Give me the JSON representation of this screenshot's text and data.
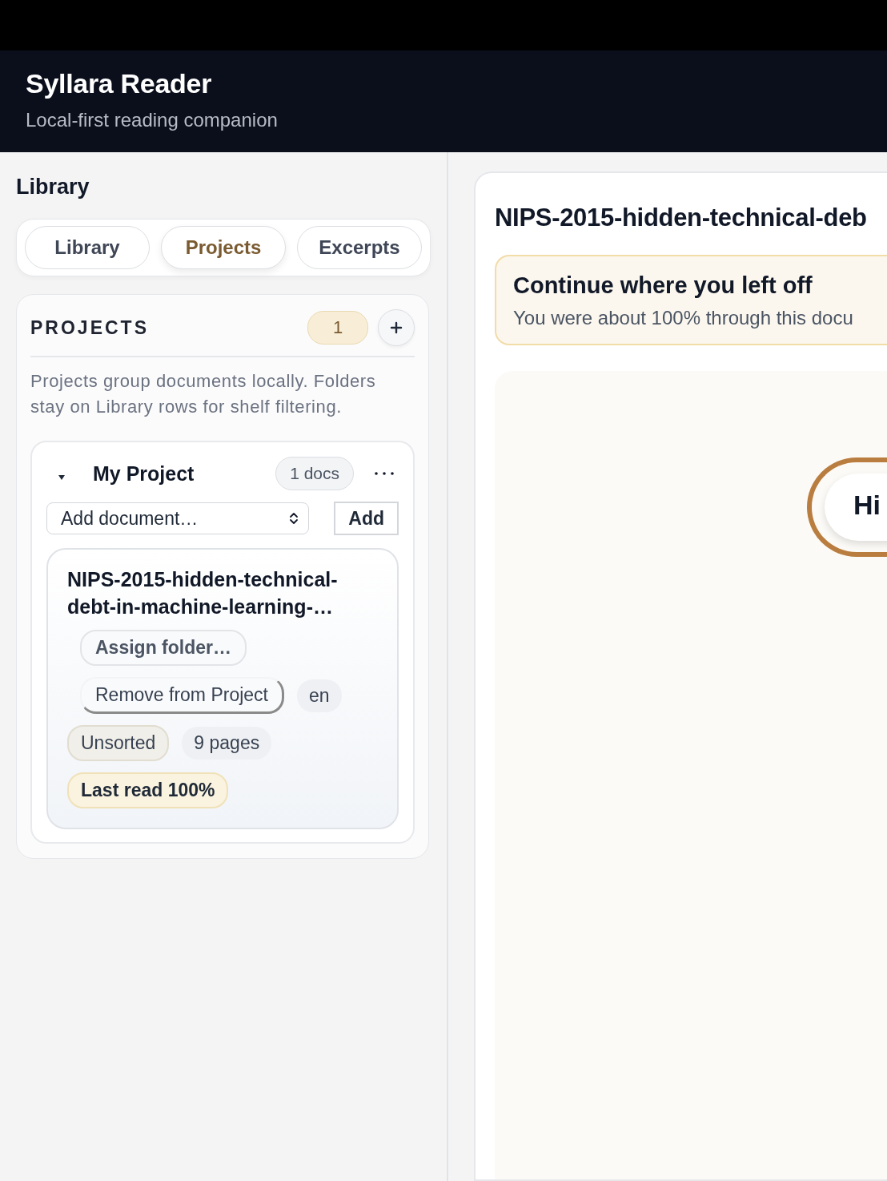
{
  "app": {
    "title": "Syllara Reader",
    "subtitle": "Local-first reading companion"
  },
  "sidebar": {
    "heading": "Library",
    "tabs": [
      {
        "label": "Library",
        "selected": false
      },
      {
        "label": "Projects",
        "selected": true
      },
      {
        "label": "Excerpts",
        "selected": false
      }
    ],
    "projects_panel": {
      "title": "PROJECTS",
      "count": "1",
      "description": "Projects group documents locally. Folders stay on Library rows for shelf filtering.",
      "projects": [
        {
          "name": "My Project",
          "expanded": true,
          "doc_count": "1 docs",
          "add_select": {
            "placeholder": "Add document…"
          },
          "add_button": "Add",
          "documents": [
            {
              "title": "NIPS-2015-hidden-technical-debt-in-machine-learning-…",
              "items": [
                {
                  "kind": "action",
                  "label": "Assign folder…"
                },
                {
                  "kind": "focused-action",
                  "label": "Remove from Project"
                },
                {
                  "kind": "plain-tag",
                  "label": "en"
                },
                {
                  "kind": "folder-tag",
                  "label": "Unsorted"
                },
                {
                  "kind": "plain-tag",
                  "label": "9 pages"
                },
                {
                  "kind": "progress-tag",
                  "label": "Last read 100%"
                }
              ]
            }
          ]
        }
      ]
    }
  },
  "reader": {
    "title": "NIPS-2015-hidden-technical-deb",
    "resume": {
      "title": "Continue where you left off",
      "text": "You were about 100% through this docu"
    },
    "page_label": "Hi"
  }
}
